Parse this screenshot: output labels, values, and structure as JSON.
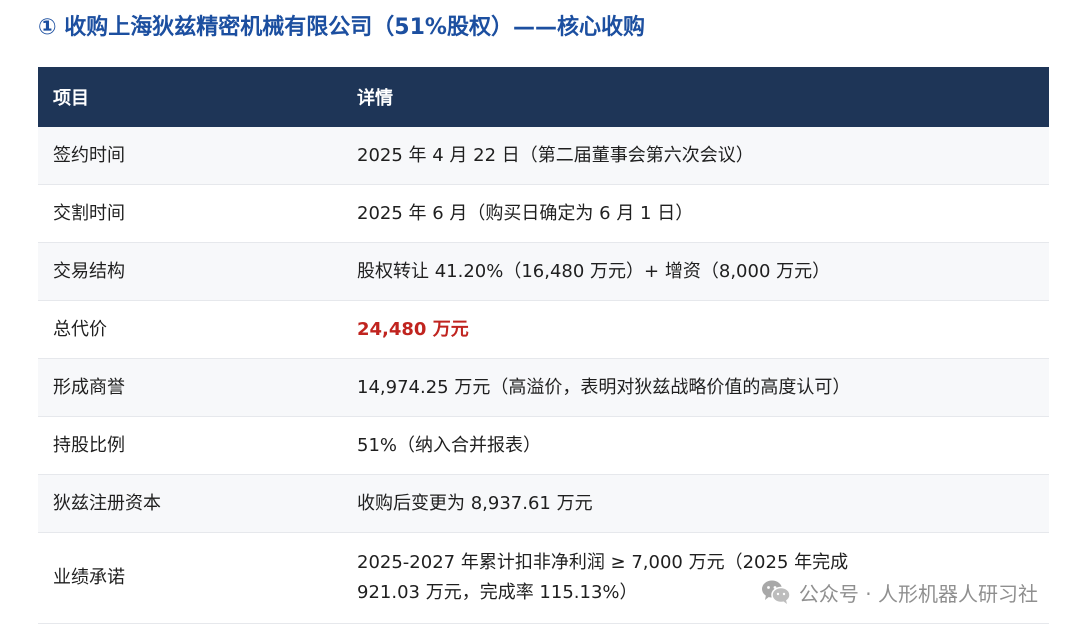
{
  "title": "① 收购上海狄兹精密机械有限公司（51%股权）——核心收购",
  "table": {
    "headers": [
      "项目",
      "详情"
    ],
    "rows": [
      {
        "item": "签约时间",
        "detail": "2025 年 4 月 22 日（第二届董事会第六次会议）"
      },
      {
        "item": "交割时间",
        "detail": "2025 年 6 月（购买日确定为 6 月 1 日）"
      },
      {
        "item": "交易结构",
        "detail": "股权转让 41.20%（16,480 万元）+ 增资（8,000 万元）"
      },
      {
        "item": "总代价",
        "detail": "24,480 万元"
      },
      {
        "item": "形成商誉",
        "detail": "14,974.25 万元（高溢价，表明对狄兹战略价值的高度认可）"
      },
      {
        "item": "持股比例",
        "detail": "51%（纳入合并报表）"
      },
      {
        "item": "狄兹注册资本",
        "detail": "收购后变更为 8,937.61 万元"
      },
      {
        "item": "业绩承诺",
        "detail": "2025-2027 年累计扣非净利润 ≥ 7,000 万元（2025 年完成 921.03 万元，完成率 115.13%）"
      }
    ]
  },
  "watermark": {
    "icon": "wechat-icon",
    "text": "公众号 · 人形机器人研习社"
  },
  "colors": {
    "title": "#1c4fa0",
    "header_bg": "#1e3557",
    "highlight": "#c0241f"
  }
}
